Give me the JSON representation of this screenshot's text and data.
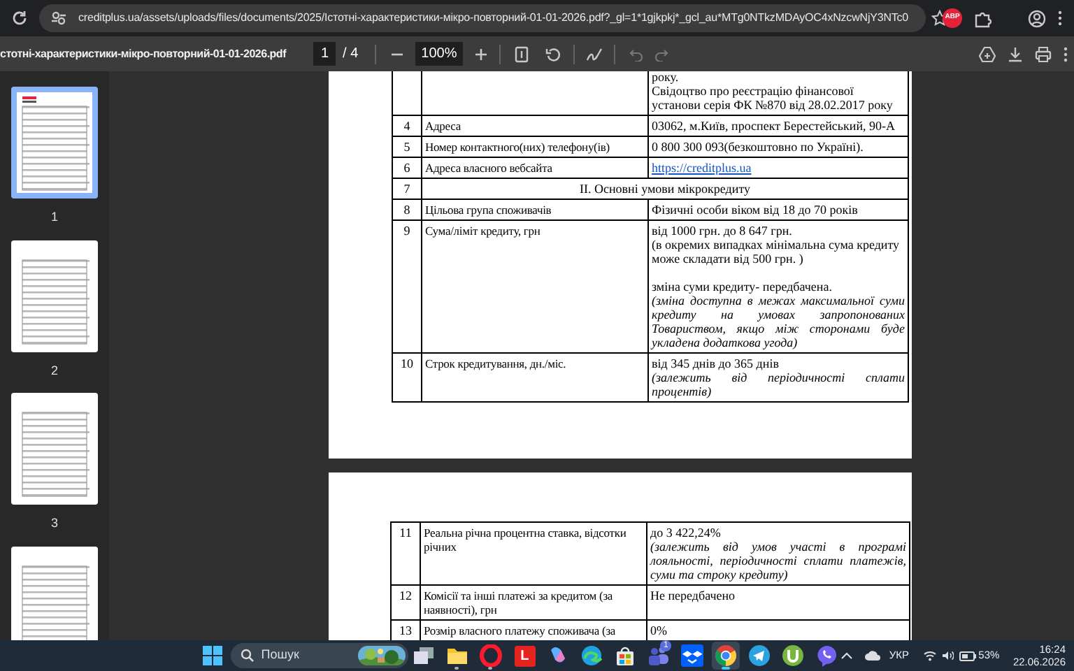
{
  "browser": {
    "url": "creditplus.ua/assets/uploads/files/documents/2025/Істотні-характеристики-мікро-повторний-01-01-2026.pdf?_gl=1*1gjkpkj*_gcl_au*MTg0NTkzMDAyOC4xNzcwNjY3NTc0",
    "adblock_label": "ABP"
  },
  "pdf_toolbar": {
    "title": "стотні-характеристики-мікро-повторний-01-01-2026.pdf",
    "page_current": "1",
    "page_total": "/ 4",
    "zoom": "100%"
  },
  "thumbnails": [
    {
      "label": "1",
      "selected": true
    },
    {
      "label": "2",
      "selected": false
    },
    {
      "label": "3",
      "selected": false
    },
    {
      "selected": false
    }
  ],
  "pages": [
    {
      "rows": [
        {
          "kind": "row",
          "number": "",
          "label": [],
          "value": [
            {
              "italic": false,
              "lines": [
                "року.",
                "Свідоцтво про реєстрацію фінансової",
                "установи серія ФК №870 від 28.02.2017 року"
              ]
            }
          ]
        },
        {
          "kind": "row",
          "number": "4",
          "label": [
            "Адреса"
          ],
          "value": [
            {
              "italic": false,
              "lines": [
                "03062, м.Київ, проспект Берестейський, 90-А"
              ]
            }
          ]
        },
        {
          "kind": "row",
          "number": "5",
          "label": [
            "Номер контактного(них) телефону(ів)"
          ],
          "value": [
            {
              "italic": false,
              "lines": [
                "0 800 300 093(безкоштовно по Україні)."
              ]
            }
          ]
        },
        {
          "kind": "row",
          "number": "6",
          "label": [
            "Адреса власного вебсайта"
          ],
          "value": [
            {
              "italic": false,
              "link": true,
              "lines": [
                "https://creditplus.ua"
              ]
            }
          ]
        },
        {
          "kind": "section",
          "number": "7",
          "title": "II. Основні умови мікрокредиту"
        },
        {
          "kind": "row",
          "number": "8",
          "label": [
            "Цільова група споживачів"
          ],
          "value": [
            {
              "italic": false,
              "lines": [
                "Фізичні особи віком від 18 до 70 років"
              ]
            }
          ]
        },
        {
          "kind": "row",
          "number": "9",
          "label": [
            "Сума/ліміт кредиту, грн"
          ],
          "value": [
            {
              "italic": false,
              "lines": [
                "від 1000 грн. до 8 647 грн.",
                "(в окремих випадках мінімальна сума кредиту",
                "може складати від 500 грн. )"
              ]
            },
            {
              "italic": false,
              "lines": [
                "зміна суми кредиту- передбачена."
              ]
            },
            {
              "italic": true,
              "lines": [
                "(зміна доступна в межах максимальної суми",
                "кредиту на умовах запропонованих",
                "Товариством, якщо між сторонами буде",
                "укладена додаткова угода)"
              ]
            }
          ]
        },
        {
          "kind": "row",
          "number": "10",
          "label": [
            "Строк кредитування, дн./міс."
          ],
          "value": [
            {
              "italic": false,
              "lines": [
                "від 345 днів до 365 днів"
              ]
            },
            {
              "italic": true,
              "lines": [
                "(залежить від періодичності сплати",
                "процентів)"
              ]
            }
          ]
        }
      ]
    },
    {
      "rows": [
        {
          "kind": "row",
          "number": "11",
          "label": [
            "Реальна річна процентна ставка, відсотки",
            "річних"
          ],
          "value": [
            {
              "italic": false,
              "lines": [
                "до 3 422,24%"
              ]
            },
            {
              "italic": true,
              "lines": [
                "(залежить від умов участі в програмі",
                "лояльності, періодичності сплати платежів,",
                "суми та строку кредиту)"
              ]
            }
          ]
        },
        {
          "kind": "row",
          "number": "12",
          "label": [
            "Комісії та інші платежі за кредитом (за",
            "наявності), грн"
          ],
          "value": [
            {
              "italic": false,
              "lines": [
                "Не передбачено"
              ]
            }
          ]
        },
        {
          "kind": "row",
          "number": "13",
          "label": [
            "Розмір власного платежу споживача (за"
          ],
          "value": [
            {
              "italic": false,
              "lines": [
                "0%"
              ]
            }
          ]
        }
      ]
    }
  ],
  "taskbar": {
    "search_placeholder": "Пошук",
    "apps": [
      {
        "kind": "taskview",
        "running": false,
        "selected": false
      },
      {
        "kind": "folder",
        "running": true,
        "selected": false
      },
      {
        "kind": "opera",
        "running": true,
        "selected": false
      },
      {
        "kind": "letter",
        "label": "L",
        "running": false,
        "selected": false
      },
      {
        "kind": "copilot",
        "running": false,
        "selected": false
      },
      {
        "kind": "edge",
        "running": false,
        "selected": false
      },
      {
        "kind": "store",
        "running": false,
        "selected": false
      },
      {
        "kind": "teams",
        "badge": "1",
        "running": false,
        "selected": false
      },
      {
        "kind": "dropbox",
        "running": false,
        "selected": false
      },
      {
        "kind": "chrome",
        "running": true,
        "selected": true
      },
      {
        "kind": "telegram",
        "running": false,
        "selected": false
      },
      {
        "kind": "torrent",
        "running": false,
        "selected": false
      },
      {
        "kind": "viber",
        "running": false,
        "selected": false
      }
    ],
    "language": "УКР",
    "battery": "53%",
    "time": "16:24",
    "date": "22.06.2026"
  }
}
